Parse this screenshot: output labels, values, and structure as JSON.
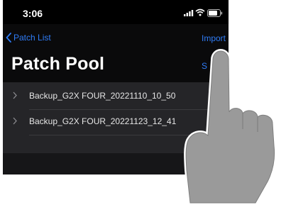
{
  "status_bar": {
    "time": "3:06",
    "icons": [
      "signal-icon",
      "wifi-icon",
      "battery-icon"
    ]
  },
  "nav": {
    "back_label": "Patch List",
    "back_icon": "chevron-left-icon",
    "import_label": "Import",
    "title": "Patch Pool",
    "select_label": "S"
  },
  "files": [
    {
      "name": "Backup_G2X FOUR_20221110_10_50",
      "icon": "chevron-right-icon"
    },
    {
      "name": "Backup_G2X FOUR_20221123_12_41",
      "icon": "chevron-right-icon"
    }
  ],
  "overlay": {
    "icon": "pointing-hand-icon",
    "color": "#9a9a9a"
  },
  "colors": {
    "accent": "#2f7cf6",
    "background": "#161618",
    "list_background": "#252528"
  }
}
